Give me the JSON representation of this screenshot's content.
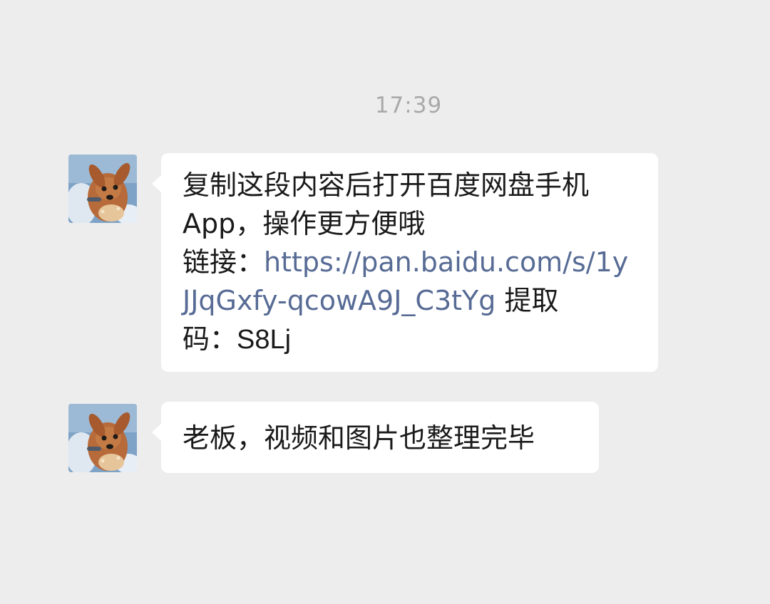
{
  "timestamp": "17:39",
  "messages": [
    {
      "type": "text",
      "line1": "复制这段内容后打开百度网盘手机",
      "line2": "App，操作更方便哦",
      "line3_prefix": "链接：",
      "line3_link": "https://pan.baidu.com/s/1y",
      "line4_link": "JJqGxfy-qcowA9J_C3tYg",
      "line4_suffix": " 提取",
      "line5_prefix": "码：",
      "line5_code": "S8Lj"
    },
    {
      "type": "text",
      "text": "老板，视频和图片也整理完毕"
    }
  ],
  "colors": {
    "background": "#ededed",
    "bubble": "#ffffff",
    "link": "#576b95",
    "timestamp": "#a9a9a9"
  },
  "icons": {
    "avatar": "fawn-cartoon-avatar"
  }
}
